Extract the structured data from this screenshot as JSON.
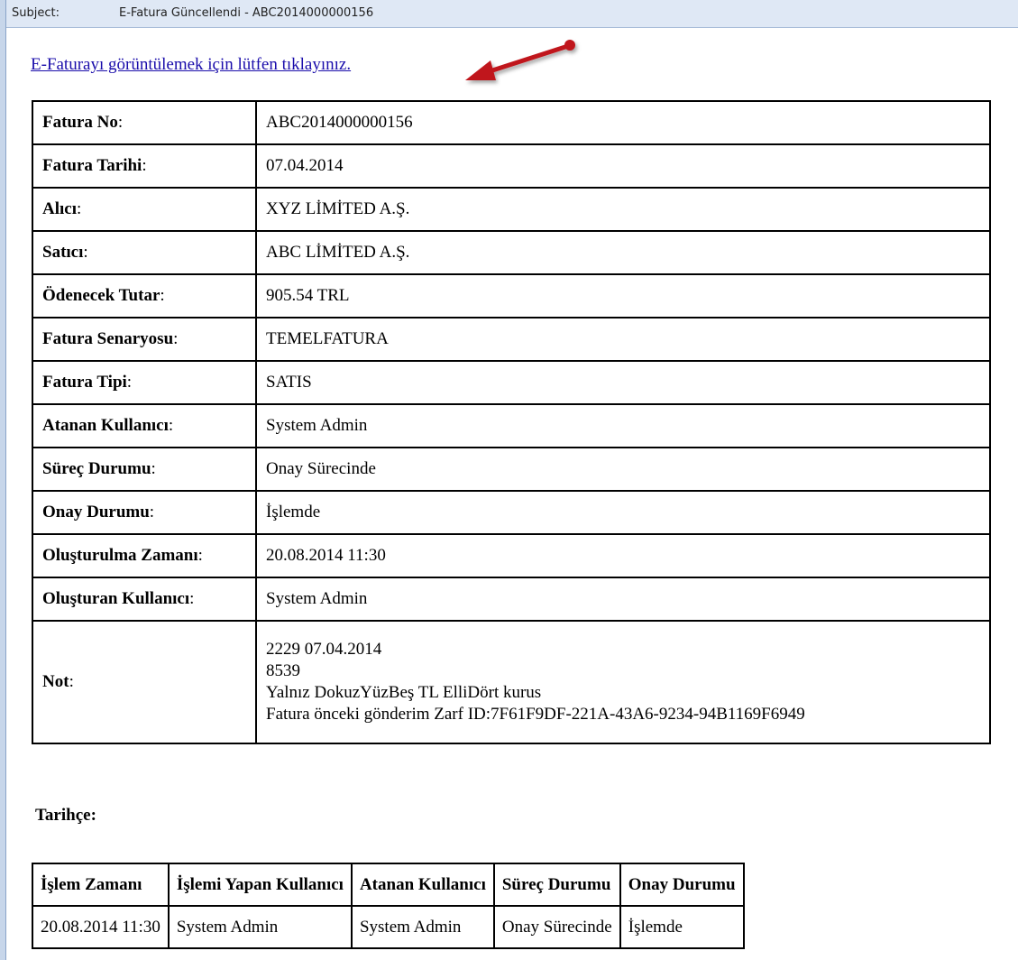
{
  "subject": {
    "label": "Subject:",
    "value": "E-Fatura Güncellendi - ABC2014000000156"
  },
  "link_text": "E-Faturayı görüntülemek için lütfen tıklayınız.",
  "colors": {
    "link": "#1a0dab",
    "arrow": "#c0161c",
    "subject_bar": "#dfe8f5"
  },
  "icons": {
    "arrow": "red-pointer-arrow-icon"
  },
  "invoice": {
    "rows": [
      {
        "key": "Fatura No",
        "value": "ABC2014000000156"
      },
      {
        "key": "Fatura Tarihi",
        "value": "07.04.2014"
      },
      {
        "key": "Alıcı",
        "value": "XYZ LİMİTED A.Ş."
      },
      {
        "key": "Satıcı",
        "value": "ABC LİMİTED A.Ş."
      },
      {
        "key": "Ödenecek Tutar",
        "value": "905.54 TRL"
      },
      {
        "key": "Fatura Senaryosu",
        "value": "TEMELFATURA"
      },
      {
        "key": "Fatura Tipi",
        "value": "SATIS"
      },
      {
        "key": "Atanan Kullanıcı",
        "value": "System Admin"
      },
      {
        "key": "Süreç Durumu",
        "value": "Onay Sürecinde"
      },
      {
        "key": "Onay Durumu",
        "value": "İşlemde"
      },
      {
        "key": "Oluşturulma Zamanı",
        "value": "20.08.2014 11:30"
      },
      {
        "key": "Oluşturan Kullanıcı",
        "value": "System Admin"
      }
    ],
    "note": {
      "key": "Not",
      "lines": [
        "2229 07.04.2014",
        "8539",
        "Yalnız DokuzYüzBeş TL ElliDört kurus",
        "Fatura önceki gönderim Zarf ID:7F61F9DF-221A-43A6-9234-94B1169F6949"
      ]
    }
  },
  "history": {
    "title": "Tarihçe:",
    "headers": [
      "İşlem Zamanı",
      "İşlemi Yapan Kullanıcı",
      "Atanan Kullanıcı",
      "Süreç Durumu",
      "Onay Durumu"
    ],
    "rows": [
      [
        "20.08.2014 11:30",
        "System Admin",
        "System Admin",
        "Onay Sürecinde",
        "İşlemde"
      ]
    ]
  }
}
